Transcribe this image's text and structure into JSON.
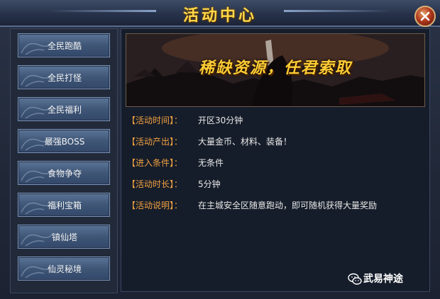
{
  "window": {
    "title": "活动中心"
  },
  "sidebar": {
    "items": [
      {
        "label": "全民跑酷"
      },
      {
        "label": "全民打怪"
      },
      {
        "label": "全民福利"
      },
      {
        "label": "最强BOSS"
      },
      {
        "label": "食物争夺"
      },
      {
        "label": "福利宝箱"
      },
      {
        "label": "镇仙塔"
      },
      {
        "label": "仙灵秘境"
      }
    ]
  },
  "banner": {
    "text": "稀缺资源，任君索取"
  },
  "details": [
    {
      "key": "【活动时间】：",
      "value": "开区30分钟"
    },
    {
      "key": "【活动产出】：",
      "value": "大量金币、材料、装备！"
    },
    {
      "key": "【进入条件】：",
      "value": "无条件"
    },
    {
      "key": "【活动时长】：",
      "value": "5分钟"
    },
    {
      "key": "【活动说明】：",
      "value": "在主城安全区随意跑动，即可随机获得大量奖励"
    }
  ],
  "watermark": {
    "text": "武易神途",
    "icon": "wechat-icon"
  },
  "colors": {
    "title": "#ffd84a",
    "key": "#f0a040",
    "value": "#e8e8e8"
  }
}
